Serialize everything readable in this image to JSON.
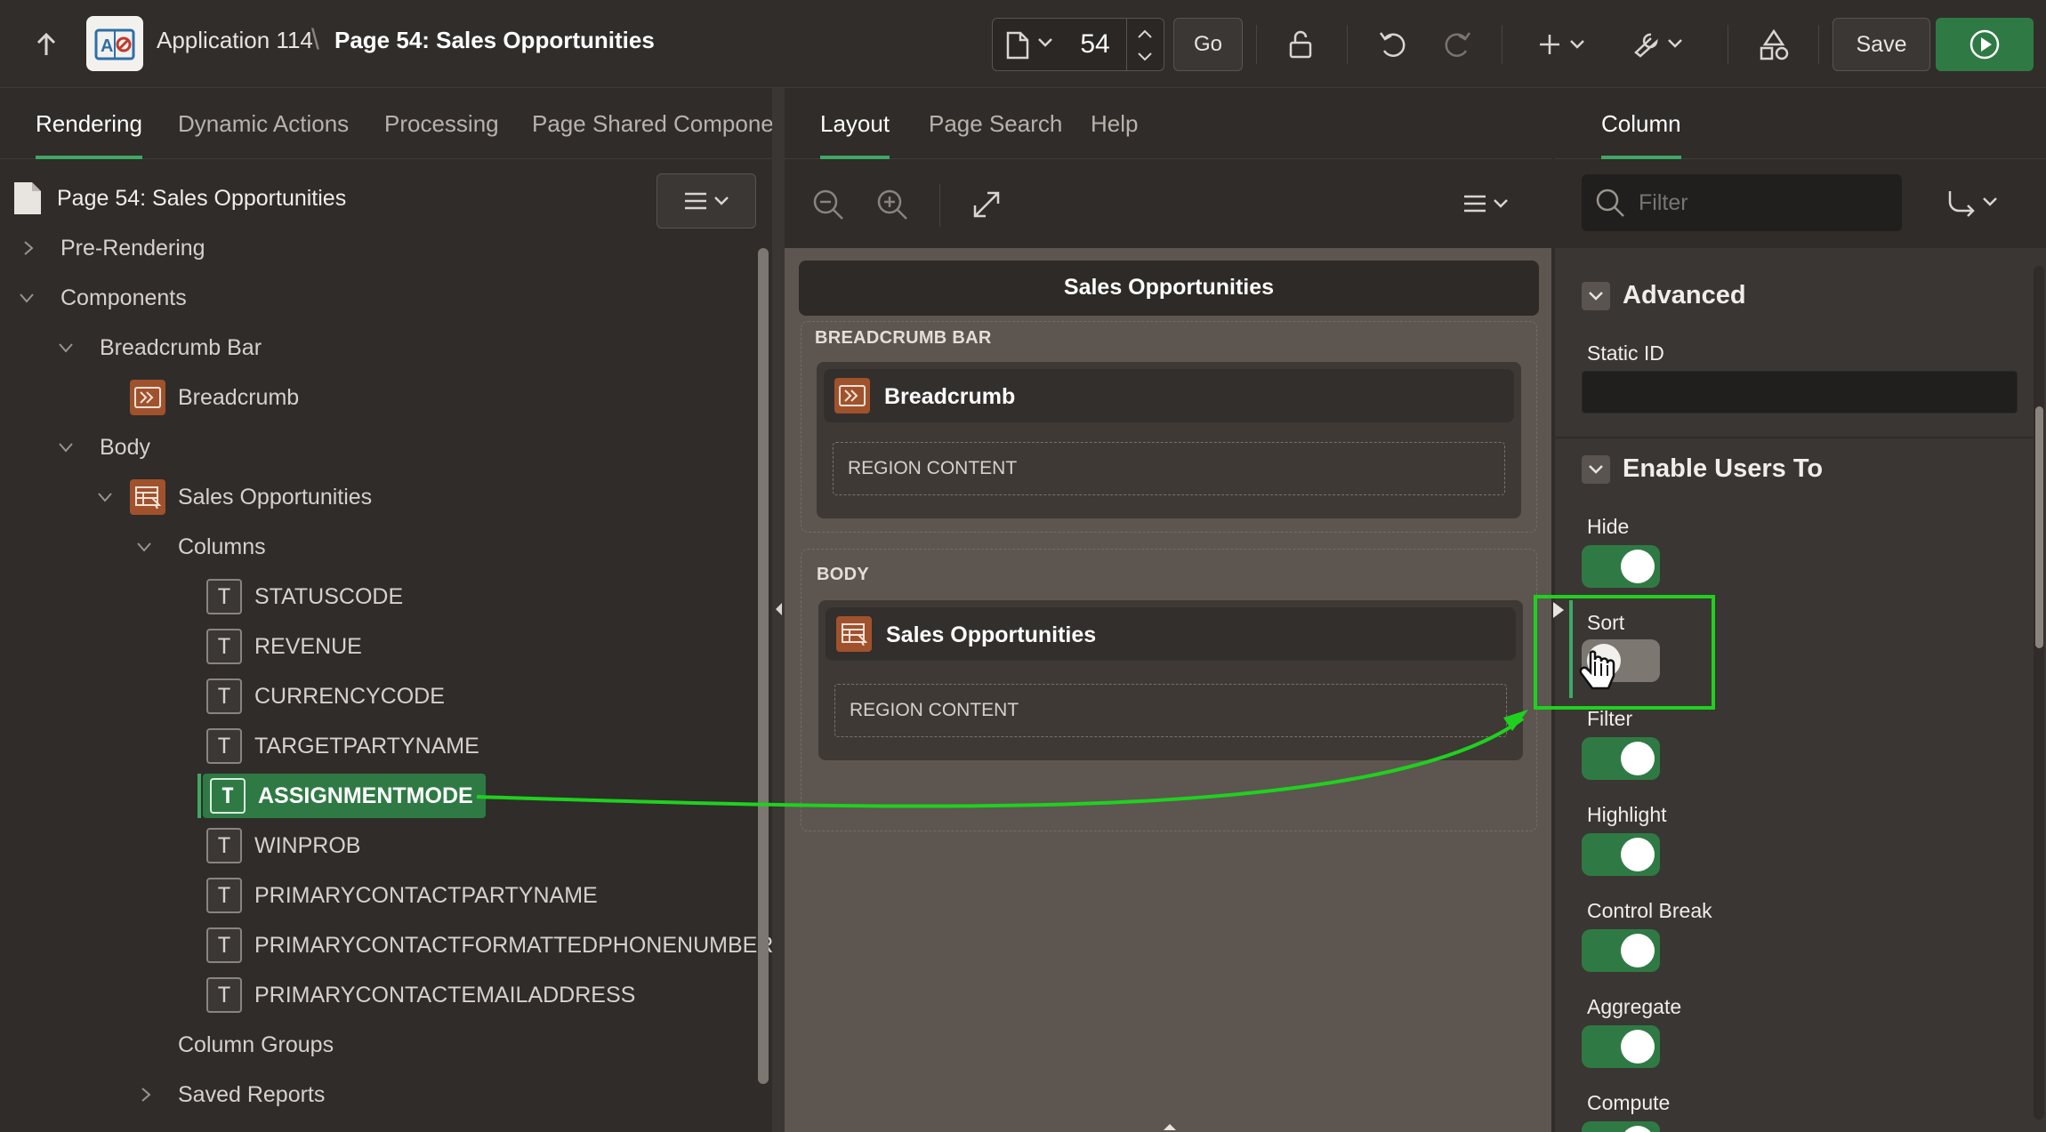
{
  "header": {
    "app_name": "Application 114",
    "page_title": "Page 54: Sales Opportunities",
    "page_number": "54",
    "go_label": "Go",
    "save_label": "Save"
  },
  "left_panel": {
    "tabs": [
      "Rendering",
      "Dynamic Actions",
      "Processing",
      "Page Shared Component"
    ],
    "root_label": "Page 54: Sales Opportunities",
    "tree": {
      "pre_rendering": "Pre-Rendering",
      "components": "Components",
      "breadcrumb_bar": "Breadcrumb Bar",
      "breadcrumb": "Breadcrumb",
      "body": "Body",
      "region": "Sales Opportunities",
      "columns": "Columns",
      "column_items": [
        "STATUSCODE",
        "REVENUE",
        "CURRENCYCODE",
        "TARGETPARTYNAME",
        "ASSIGNMENTMODE",
        "WINPROB",
        "PRIMARYCONTACTPARTYNAME",
        "PRIMARYCONTACTFORMATTEDPHONENUMBER",
        "PRIMARYCONTACTEMAILADDRESS"
      ],
      "selected_column": "ASSIGNMENTMODE",
      "column_groups": "Column Groups",
      "saved_reports": "Saved Reports"
    }
  },
  "center_panel": {
    "tabs": [
      "Layout",
      "Page Search",
      "Help"
    ],
    "page_title": "Sales Opportunities",
    "breadcrumb_bar_label": "BREADCRUMB BAR",
    "breadcrumb_region": "Breadcrumb",
    "region_content": "REGION CONTENT",
    "body_label": "BODY",
    "body_region": "Sales Opportunities",
    "body_region_content": "REGION CONTENT"
  },
  "right_panel": {
    "tab": "Column",
    "filter_placeholder": "Filter",
    "advanced_heading": "Advanced",
    "static_id_label": "Static ID",
    "static_id_value": "",
    "enable_users_heading": "Enable Users To",
    "switches": [
      {
        "label": "Hide",
        "on": true
      },
      {
        "label": "Sort",
        "on": false
      },
      {
        "label": "Filter",
        "on": true
      },
      {
        "label": "Highlight",
        "on": true
      },
      {
        "label": "Control Break",
        "on": true
      },
      {
        "label": "Aggregate",
        "on": true
      },
      {
        "label": "Compute",
        "on": true
      }
    ]
  },
  "colors": {
    "accent_green": "#2f7a44",
    "highlight_green": "#1fd11f",
    "region_icon": "#a0522d"
  },
  "icons": [
    "up-arrow-icon",
    "app-logo-icon",
    "page-icon",
    "chevron-down-icon",
    "unlock-icon",
    "undo-icon",
    "redo-icon",
    "plus-icon",
    "wrench-icon",
    "shapes-icon",
    "play-icon",
    "menu-icon",
    "zoom-out-icon",
    "zoom-in-icon",
    "expand-icon",
    "search-icon",
    "return-arrow-icon",
    "hand-cursor-icon"
  ]
}
